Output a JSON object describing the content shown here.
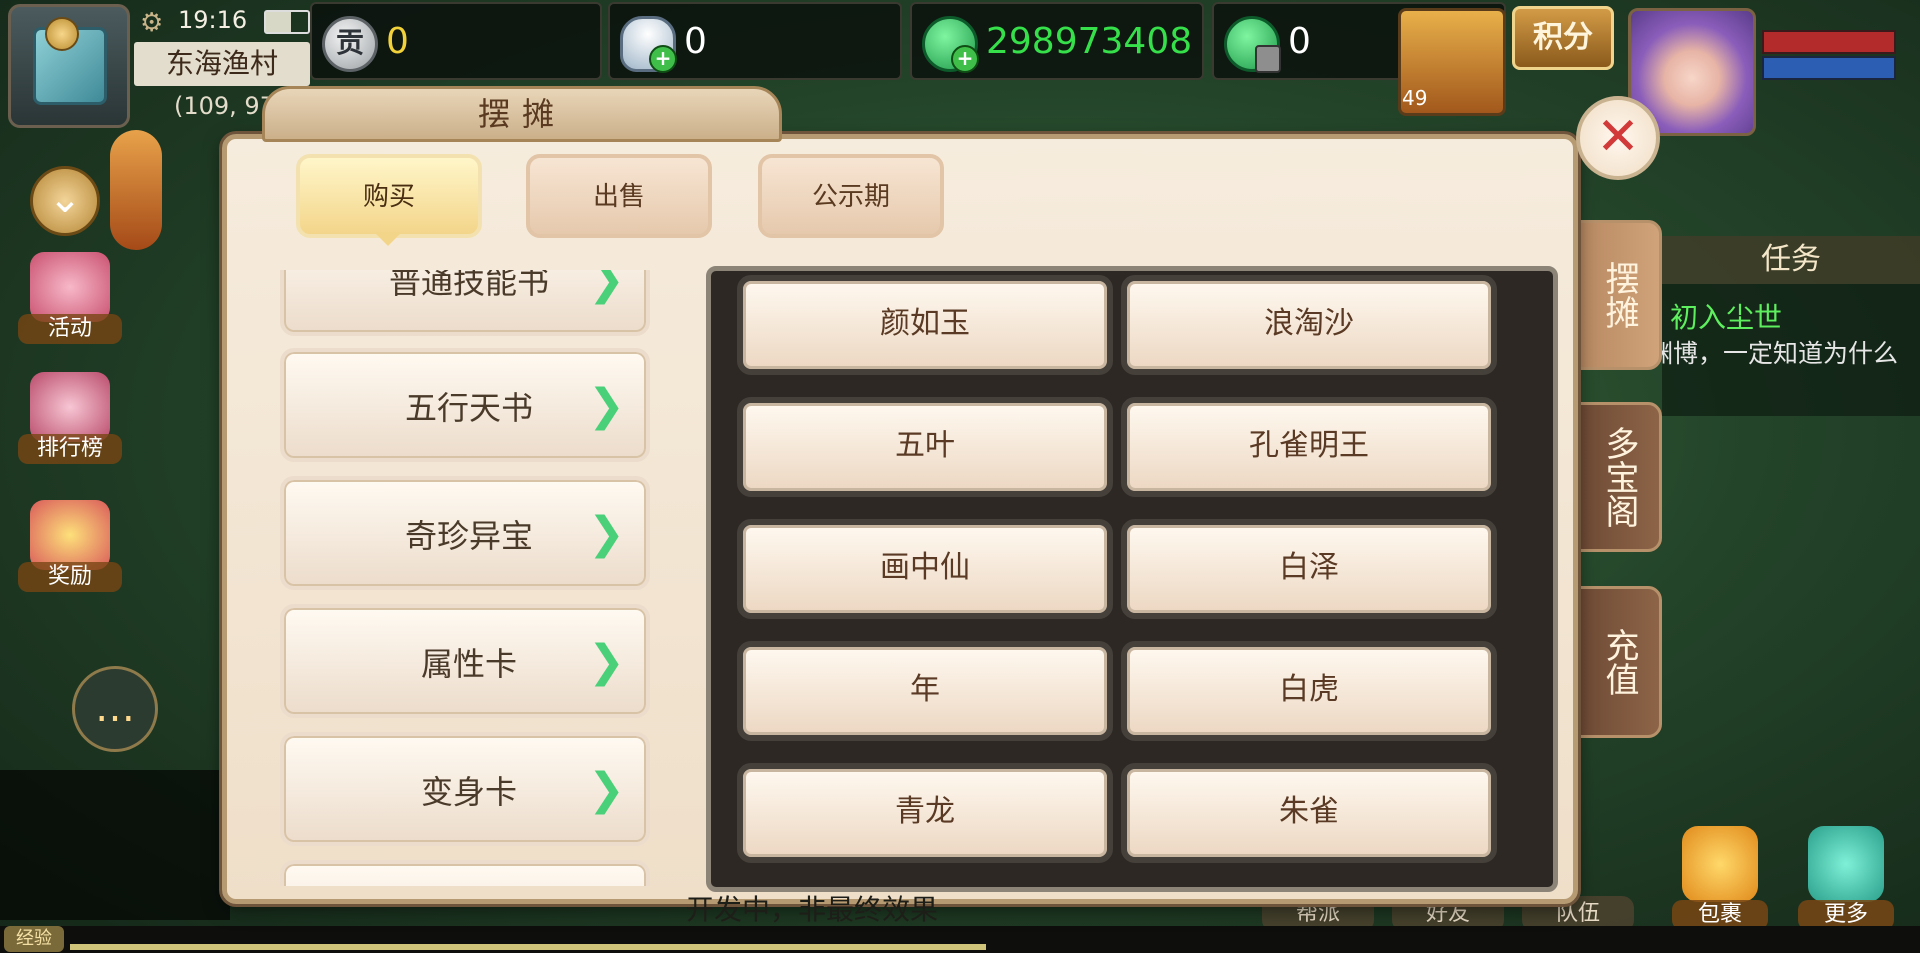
{
  "hud": {
    "time": "19:16",
    "location_name": "东海渔村",
    "location_coords": "(109, 97",
    "currencies": [
      {
        "icon": "contribution-coin-icon",
        "label": "贡",
        "value": "0",
        "color": "#f2d23a"
      },
      {
        "icon": "silver-ingot-icon",
        "value": "0",
        "color": "#ffffff"
      },
      {
        "icon": "jade-icon",
        "value": "298973408",
        "color": "#36e04a"
      },
      {
        "icon": "locked-jade-icon",
        "value": "0",
        "color": "#ffffff"
      }
    ],
    "pet_level": "49",
    "score_label": "积分"
  },
  "left_icons": [
    {
      "name": "activity",
      "label": "活动"
    },
    {
      "name": "leaderboard",
      "label": "排行榜"
    },
    {
      "name": "reward",
      "label": "奖励"
    }
  ],
  "panel": {
    "title": "摆摊",
    "tabs": [
      "购买",
      "出售",
      "公示期"
    ],
    "active_tab": 0,
    "categories": [
      "普通技能书",
      "五行天书",
      "奇珍异宝",
      "属性卡",
      "变身卡"
    ],
    "items": [
      "颜如玉",
      "浪淘沙",
      "五叶",
      "孔雀明王",
      "画中仙",
      "白泽",
      "年",
      "白虎",
      "青龙",
      "朱雀"
    ]
  },
  "side_tabs": [
    "摆摊",
    "多宝阁",
    "充值"
  ],
  "task": {
    "header": "任务",
    "name": "初入尘世",
    "desc": "学识渊博，一定知道为什么"
  },
  "bottom": {
    "buttons": [
      "帮派",
      "好友",
      "队伍"
    ],
    "bag_label": "包裹",
    "more_label": "更多",
    "footnote": "开发中，非最终效果",
    "xp_label": "经验"
  }
}
